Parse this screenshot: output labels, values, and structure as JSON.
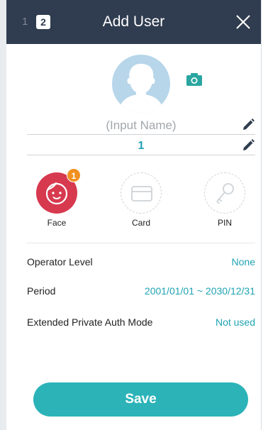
{
  "header": {
    "step_inactive": "1",
    "step_active": "2",
    "title": "Add User"
  },
  "user": {
    "name_placeholder": "(Input Name)",
    "id_value": "1"
  },
  "auth_methods": [
    {
      "label": "Face",
      "badge": "1"
    },
    {
      "label": "Card"
    },
    {
      "label": "PIN"
    }
  ],
  "settings": [
    {
      "label": "Operator Level",
      "value": "None"
    },
    {
      "label": "Period",
      "value": "2001/01/01 ~ 2030/12/31"
    },
    {
      "label": "Extended Private Auth Mode",
      "value": "Not used"
    }
  ],
  "actions": {
    "save_label": "Save"
  },
  "colors": {
    "header_bg": "#303c4f",
    "accent_teal": "#20a3b3",
    "save_button": "#2bb3b8",
    "face_red": "#d7394f",
    "badge_orange": "#f19022",
    "avatar_blue": "#b7d6ea"
  }
}
